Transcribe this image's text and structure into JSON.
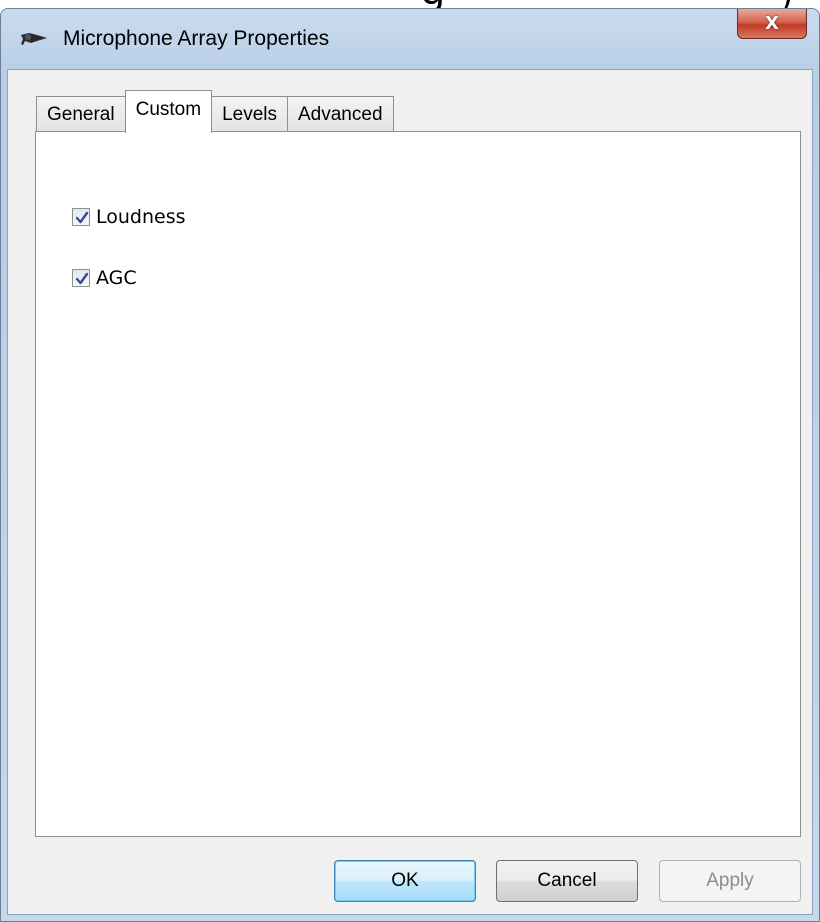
{
  "window": {
    "title": "Microphone Array Properties",
    "close_glyph": "X"
  },
  "tabs": [
    {
      "label": "General",
      "active": false
    },
    {
      "label": "Custom",
      "active": true
    },
    {
      "label": "Levels",
      "active": false
    },
    {
      "label": "Advanced",
      "active": false
    }
  ],
  "custom_tab": {
    "loudness": {
      "label": "Loudness",
      "checked": true
    },
    "agc": {
      "label": "AGC",
      "checked": true
    }
  },
  "buttons": {
    "ok_label": "OK",
    "cancel_label": "Cancel",
    "apply_label": "Apply"
  },
  "icons": {
    "title": "microphone-icon",
    "check": "checkmark-icon"
  },
  "colors": {
    "title_bar": "#c5d8ec",
    "close_button": "#c23a24",
    "default_button": "#bee6fd"
  }
}
